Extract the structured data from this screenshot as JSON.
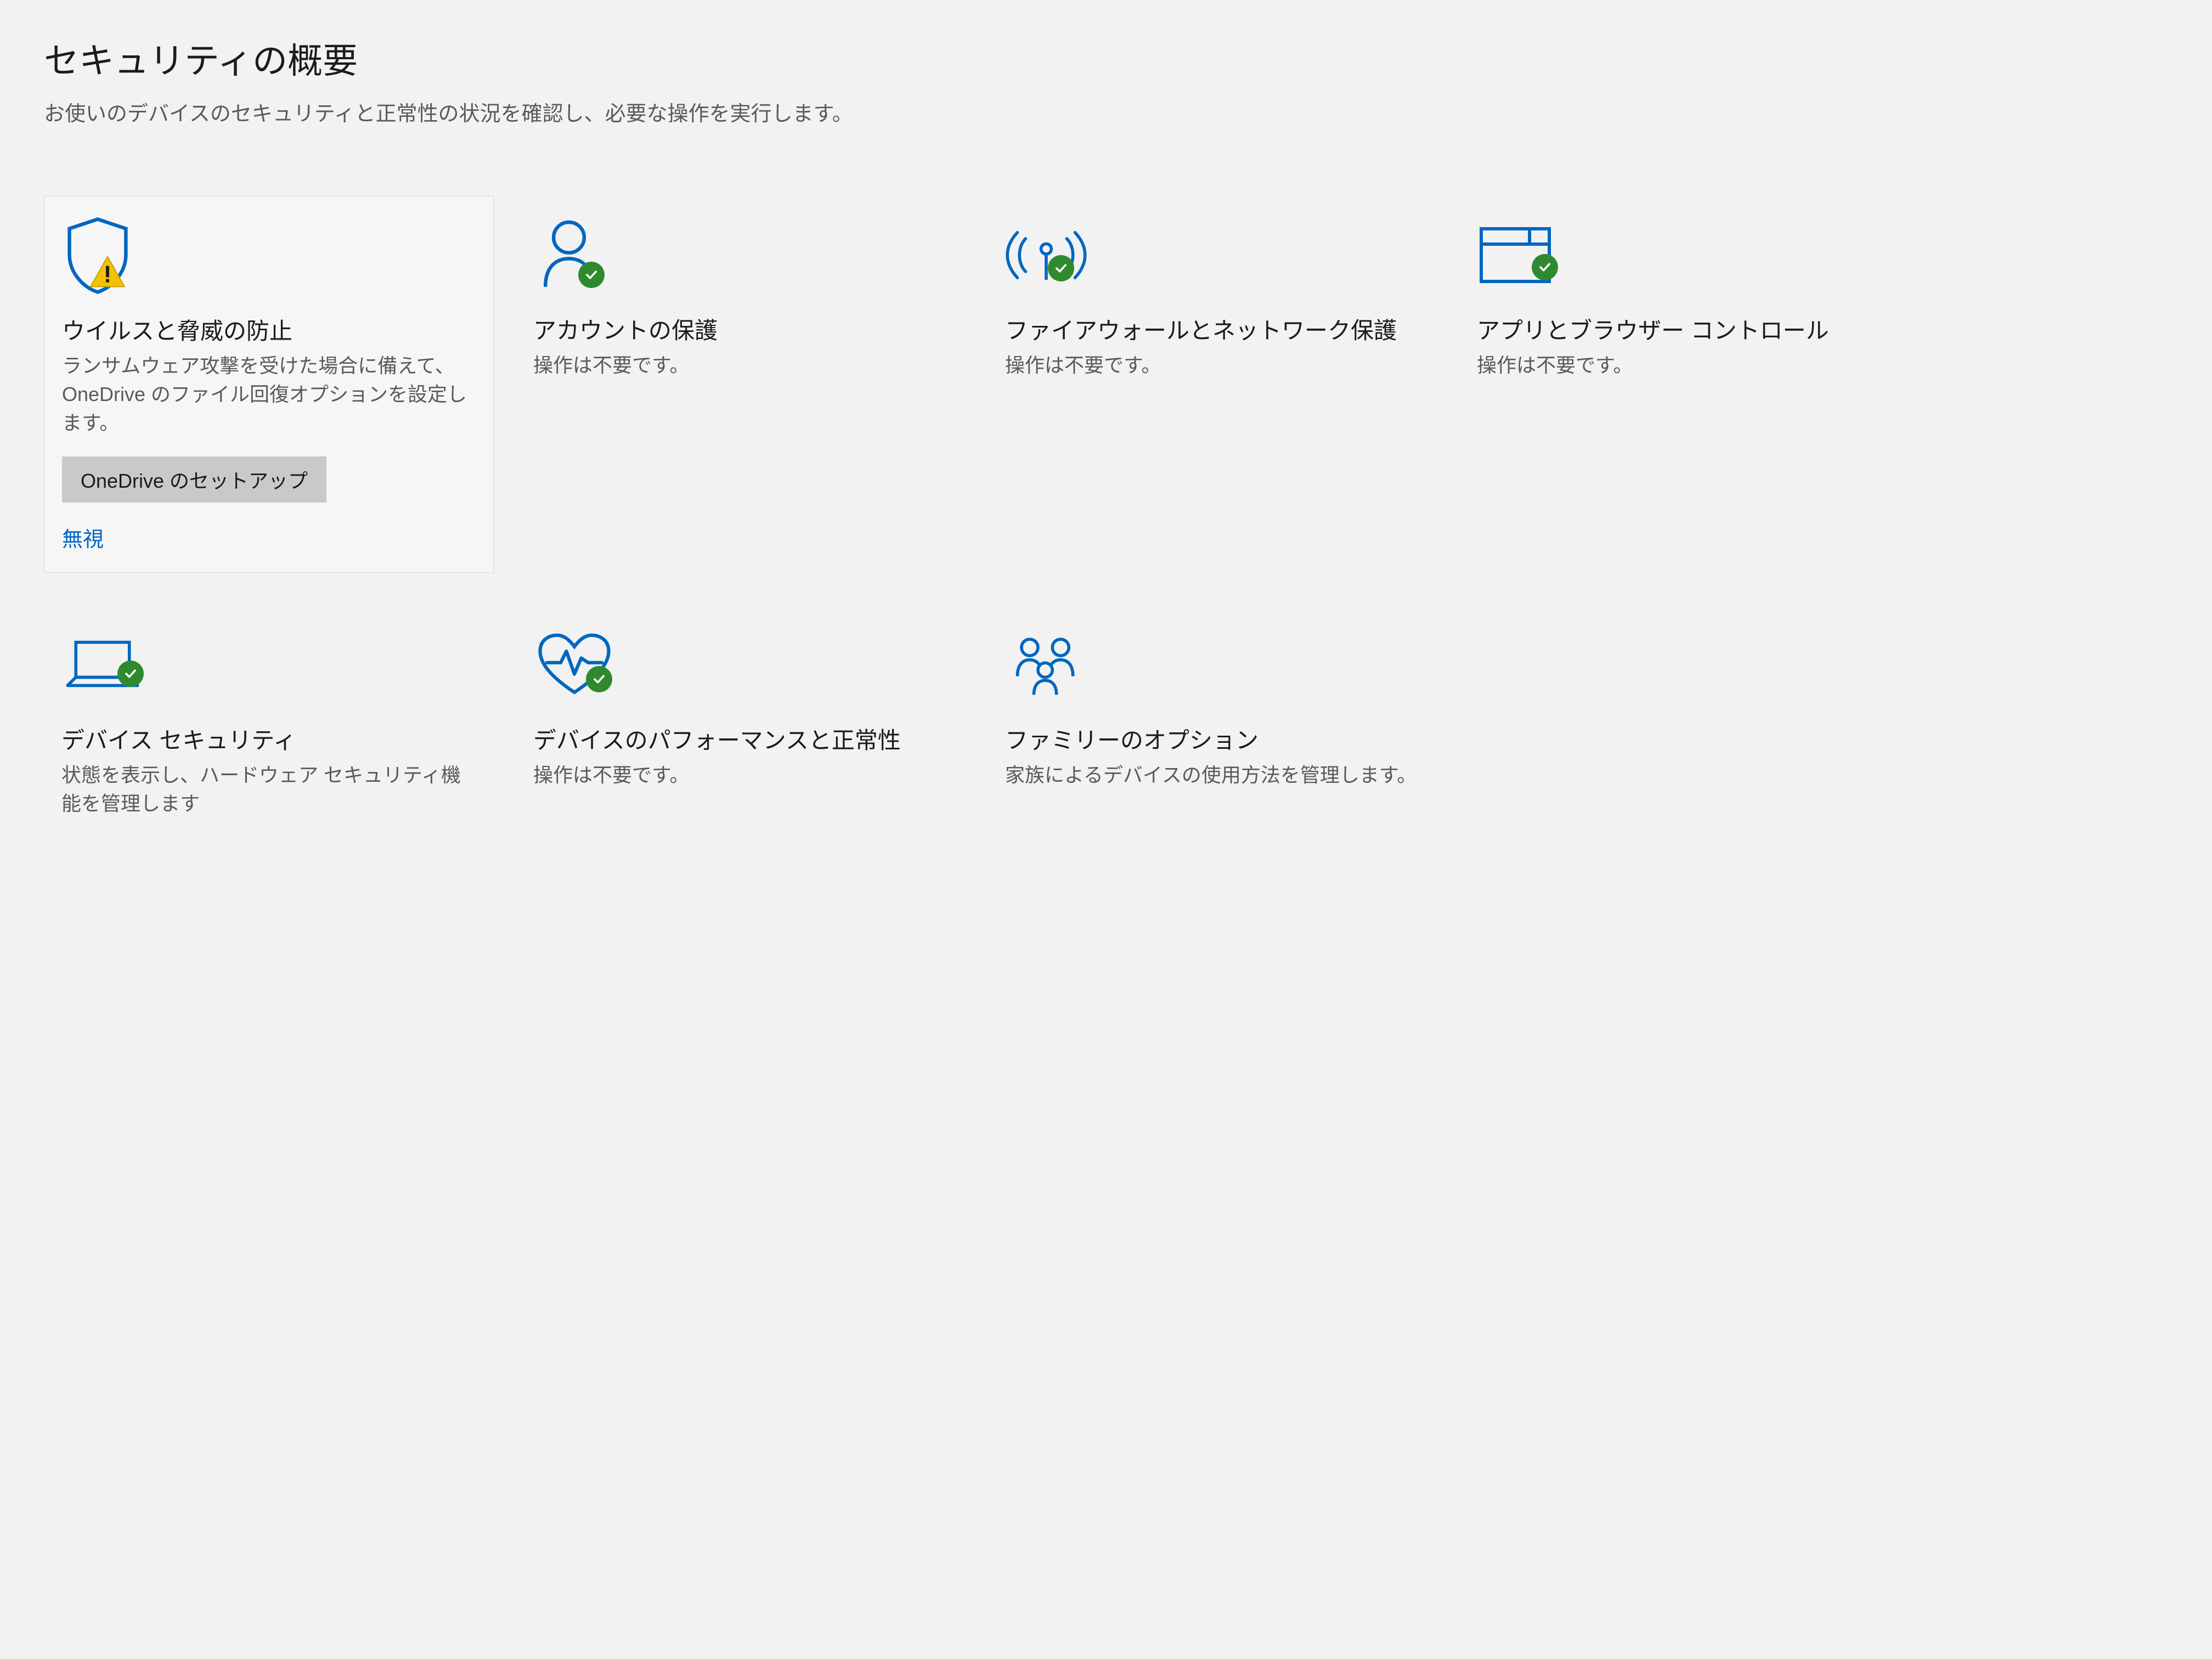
{
  "header": {
    "title": "セキュリティの概要",
    "subtitle": "お使いのデバイスのセキュリティと正常性の状況を確認し、必要な操作を実行します。"
  },
  "strings": {
    "no_action_needed": "操作は不要です。"
  },
  "tiles": {
    "virus": {
      "title": "ウイルスと脅威の防止",
      "desc": "ランサムウェア攻撃を受けた場合に備えて、OneDrive のファイル回復オプションを設定します。",
      "button_label": "OneDrive のセットアップ",
      "dismiss_label": "無視",
      "status": "warning"
    },
    "account": {
      "title": "アカウントの保護",
      "desc": "操作は不要です。",
      "status": "ok"
    },
    "firewall": {
      "title": "ファイアウォールとネットワーク保護",
      "desc": "操作は不要です。",
      "status": "ok"
    },
    "appbrowser": {
      "title": "アプリとブラウザー コントロール",
      "desc": "操作は不要です。",
      "status": "ok"
    },
    "device_security": {
      "title": "デバイス セキュリティ",
      "desc": "状態を表示し、ハードウェア セキュリティ機能を管理します",
      "status": "ok"
    },
    "performance": {
      "title": "デバイスのパフォーマンスと正常性",
      "desc": "操作は不要です。",
      "status": "ok"
    },
    "family": {
      "title": "ファミリーのオプション",
      "desc": "家族によるデバイスの使用方法を管理します。",
      "status": "none"
    }
  },
  "colors": {
    "accent_blue": "#0067c0",
    "icon_blue": "#0067c0",
    "ok_green": "#2f8a2f",
    "warn_yellow": "#f2c200"
  }
}
